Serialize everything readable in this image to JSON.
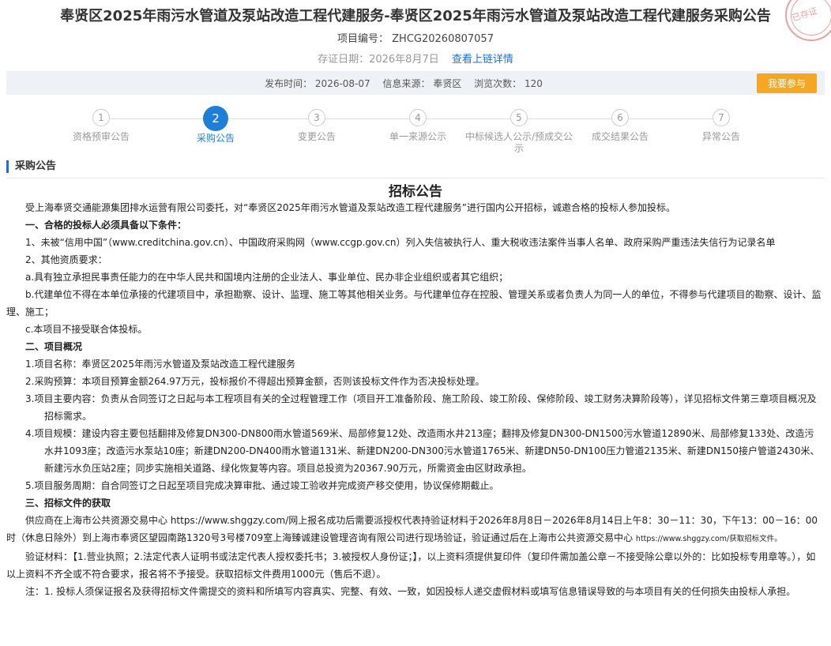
{
  "header": {
    "title": "奉贤区2025年雨污水管道及泵站改造工程代建服务-奉贤区2025年雨污水管道及泵站改造工程代建服务采购公告",
    "project_code": "项目编号： ZHCG20260807057",
    "evidence_date": "存证日期：2026年8月7日",
    "evidence_link": "查看上链详情",
    "stamp_text": "已存证"
  },
  "infobar": {
    "publish_time": "发布时间： 2026-08-07",
    "source": "信息来源： 奉贤区",
    "views": "浏览次数： 120",
    "join_button": "我要参与"
  },
  "steps": [
    {
      "num": "1",
      "label": "资格预审公告"
    },
    {
      "num": "2",
      "label": "采购公告"
    },
    {
      "num": "3",
      "label": "变更公告"
    },
    {
      "num": "4",
      "label": "单一来源公示"
    },
    {
      "num": "5",
      "label": "中标候选人公示/预成交公示"
    },
    {
      "num": "6",
      "label": "成交结果公告"
    },
    {
      "num": "7",
      "label": "异常公告"
    }
  ],
  "section_title": "采购公告",
  "document": {
    "title": "招标公告",
    "intro": "受上海奉贤交通能源集团排水运营有限公司委托，对“奉贤区2025年雨污水管道及泵站改造工程代建服务”进行国内公开招标，诚邀合格的投标人参加投标。",
    "h1": "一、合格的投标人必须具备以下条件：",
    "c1": "1、未被“信用中国”（www.creditchina.gov.cn）、中国政府采购网（www.ccgp.gov.cn）列入失信被执行人、重大税收违法案件当事人名单、政府采购严重违法失信行为记录名单",
    "c2": "2、其他资质要求：",
    "c2a": "a.具有独立承担民事责任能力的在中华人民共和国境内注册的企业法人、事业单位、民办非企业组织或者其它组织；",
    "c2b": "b.代建单位不得在本单位承接的代建项目中，承担勘察、设计、监理、施工等其他相关业务。与代建单位存在控股、管理关系或者负责人为同一人的单位，不得参与代建项目的勘察、设计、监理、施工；",
    "c2c": "c.本项目不接受联合体投标。",
    "h2": "二、项目概况",
    "p1": "1.项目名称：奉贤区2025年雨污水管道及泵站改造工程代建服务",
    "p2": "2.采购预算：本项目预算金额264.97万元，投标报价不得超出预算金额，否则该投标文件作为否决投标处理。",
    "p3": "3.项目主要内容：负责从合同签订之日起与本工程项目有关的全过程管理工作（项目开工准备阶段、施工阶段、竣工阶段、保修阶段、竣工财务决算阶段等），详见招标文件第三章项目概况及招标需求。",
    "p4": "4.项目规模：建设内容主要包括翻排及修复DN300-DN800雨水管道569米、局部修复12处、改造雨水井213座；翻排及修复DN300-DN1500污水管道12890米、局部修复133处、改造污水井1093座；改造污水泵站10座；新建DN200-DN400雨水管道131米、新建DN200-DN300污水管道1765米、新建DN50-DN100压力管道2135米、新建DN150接户管道2430米、新建污水负压站2座；同步实施相关道路、绿化恢复等内容。项目总投资为20367.90万元，所需资金由区财政承担。",
    "p5": "5.项目服务周期：自合同签订之日起至项目完成决算审批、通过竣工验收并完成资产移交使用，协议保修期截止。",
    "h3": "三、招标文件的获取",
    "s1": "供应商在上海市公共资源交易中心 https://www.shggzy.com/网上报名成功后需要派授权代表持验证材料于2026年8月8日－2026年8月14日上午8：30－11：30，下午13：00－16：00时（休息日除外）到上海市奉贤区望园南路1320号3号楼709室上海臻诚建设管理咨询有限公司进行现场验证，验证通过后在上海市公共资源交易中心",
    "s1_small": "https://www.shggzy.com/获取招标文件。",
    "s2": "验证材料：【1.营业执照；2.法定代表人证明书或法定代表人授权委托书；3.被授权人身份证；】，以上资料须提供复印件（复印件需加盖公章－不接受除公章以外的：比如投标专用章等。），如以上资料不齐全或不符合要求，报名将不予接受。获取招标文件费用1000元（售后不退）。",
    "s3": "注：1. 投标人须保证报名及获得招标文件需提交的资料和所填写内容真实、完整、有效、一致，如因投标人递交虚假材料或填写信息错误导致的与本项目有关的任何损失由投标人承担。"
  }
}
